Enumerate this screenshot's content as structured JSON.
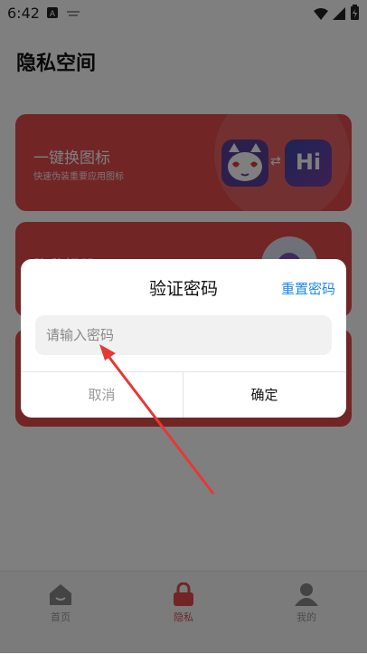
{
  "status_bar": {
    "time": "6:42"
  },
  "page": {
    "title": "隐私空间"
  },
  "cards": [
    {
      "title": "一键换图标",
      "subtitle": "快速伪装重要应用图标",
      "icon_right_text": "Hi"
    },
    {
      "title": "隐私相册",
      "subtitle": ""
    },
    {
      "title": "",
      "subtitle": ""
    }
  ],
  "bottom_nav": [
    {
      "label": "首页",
      "icon": "home-icon"
    },
    {
      "label": "隐私",
      "icon": "lock-icon"
    },
    {
      "label": "我的",
      "icon": "person-icon"
    }
  ],
  "dialog": {
    "title": "验证密码",
    "reset_label": "重置密码",
    "input_placeholder": "请输入密码",
    "input_value": "",
    "cancel_label": "取消",
    "confirm_label": "确定"
  },
  "colors": {
    "accent_red": "#e34b4b",
    "link_blue": "#1e88e5",
    "arrow_red": "#e53935"
  }
}
